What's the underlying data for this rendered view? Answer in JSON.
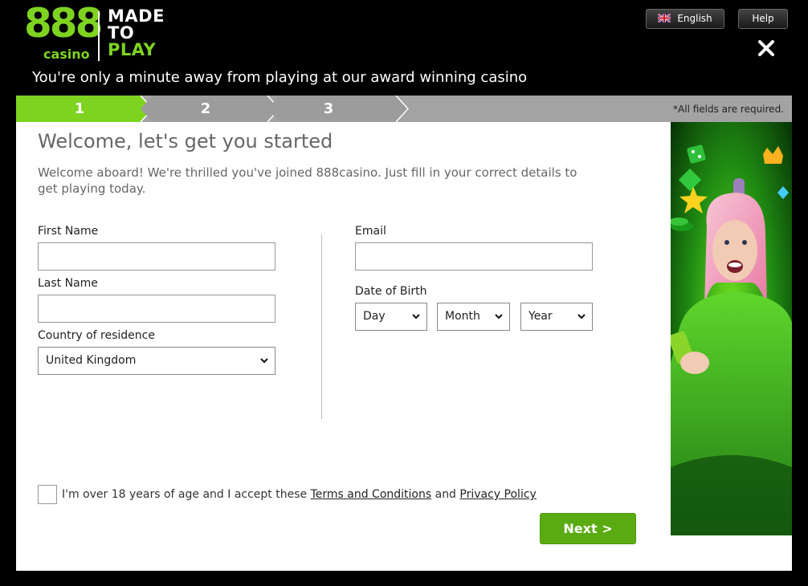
{
  "brand": {
    "logo_number": "888",
    "logo_casino": "casino",
    "logo_line1": "MADE",
    "logo_line2": "TO",
    "logo_line3": "PLAY",
    "accent_color": "#7ed321"
  },
  "header": {
    "tagline": "You're only a minute away from playing at our award winning casino",
    "language_label": "English",
    "help_label": "Help",
    "close_icon": "close-icon"
  },
  "steps": {
    "items": [
      "1",
      "2",
      "3"
    ],
    "active": 1,
    "required_note": "*All fields are required."
  },
  "form": {
    "title": "Welcome, let's get you started",
    "intro": "Welcome aboard! We're thrilled you've joined 888casino. Just fill in your correct details to get playing today.",
    "first_name_label": "First Name",
    "first_name_value": "",
    "last_name_label": "Last Name",
    "last_name_value": "",
    "country_label": "Country of residence",
    "country_value": "United Kingdom",
    "email_label": "Email",
    "email_value": "",
    "dob_label": "Date of Birth",
    "dob_day": "Day",
    "dob_month": "Month",
    "dob_year": "Year",
    "consent_prefix": "I'm over 18 years of age and I accept these",
    "consent_terms": "Terms and Conditions",
    "consent_and": "and",
    "consent_privacy": "Privacy Policy",
    "consent_checked": false,
    "next_label": "Next >"
  },
  "colors": {
    "step_active": "#7ed321",
    "step_inactive": "#a3a3a3",
    "button": "#5aab12"
  }
}
